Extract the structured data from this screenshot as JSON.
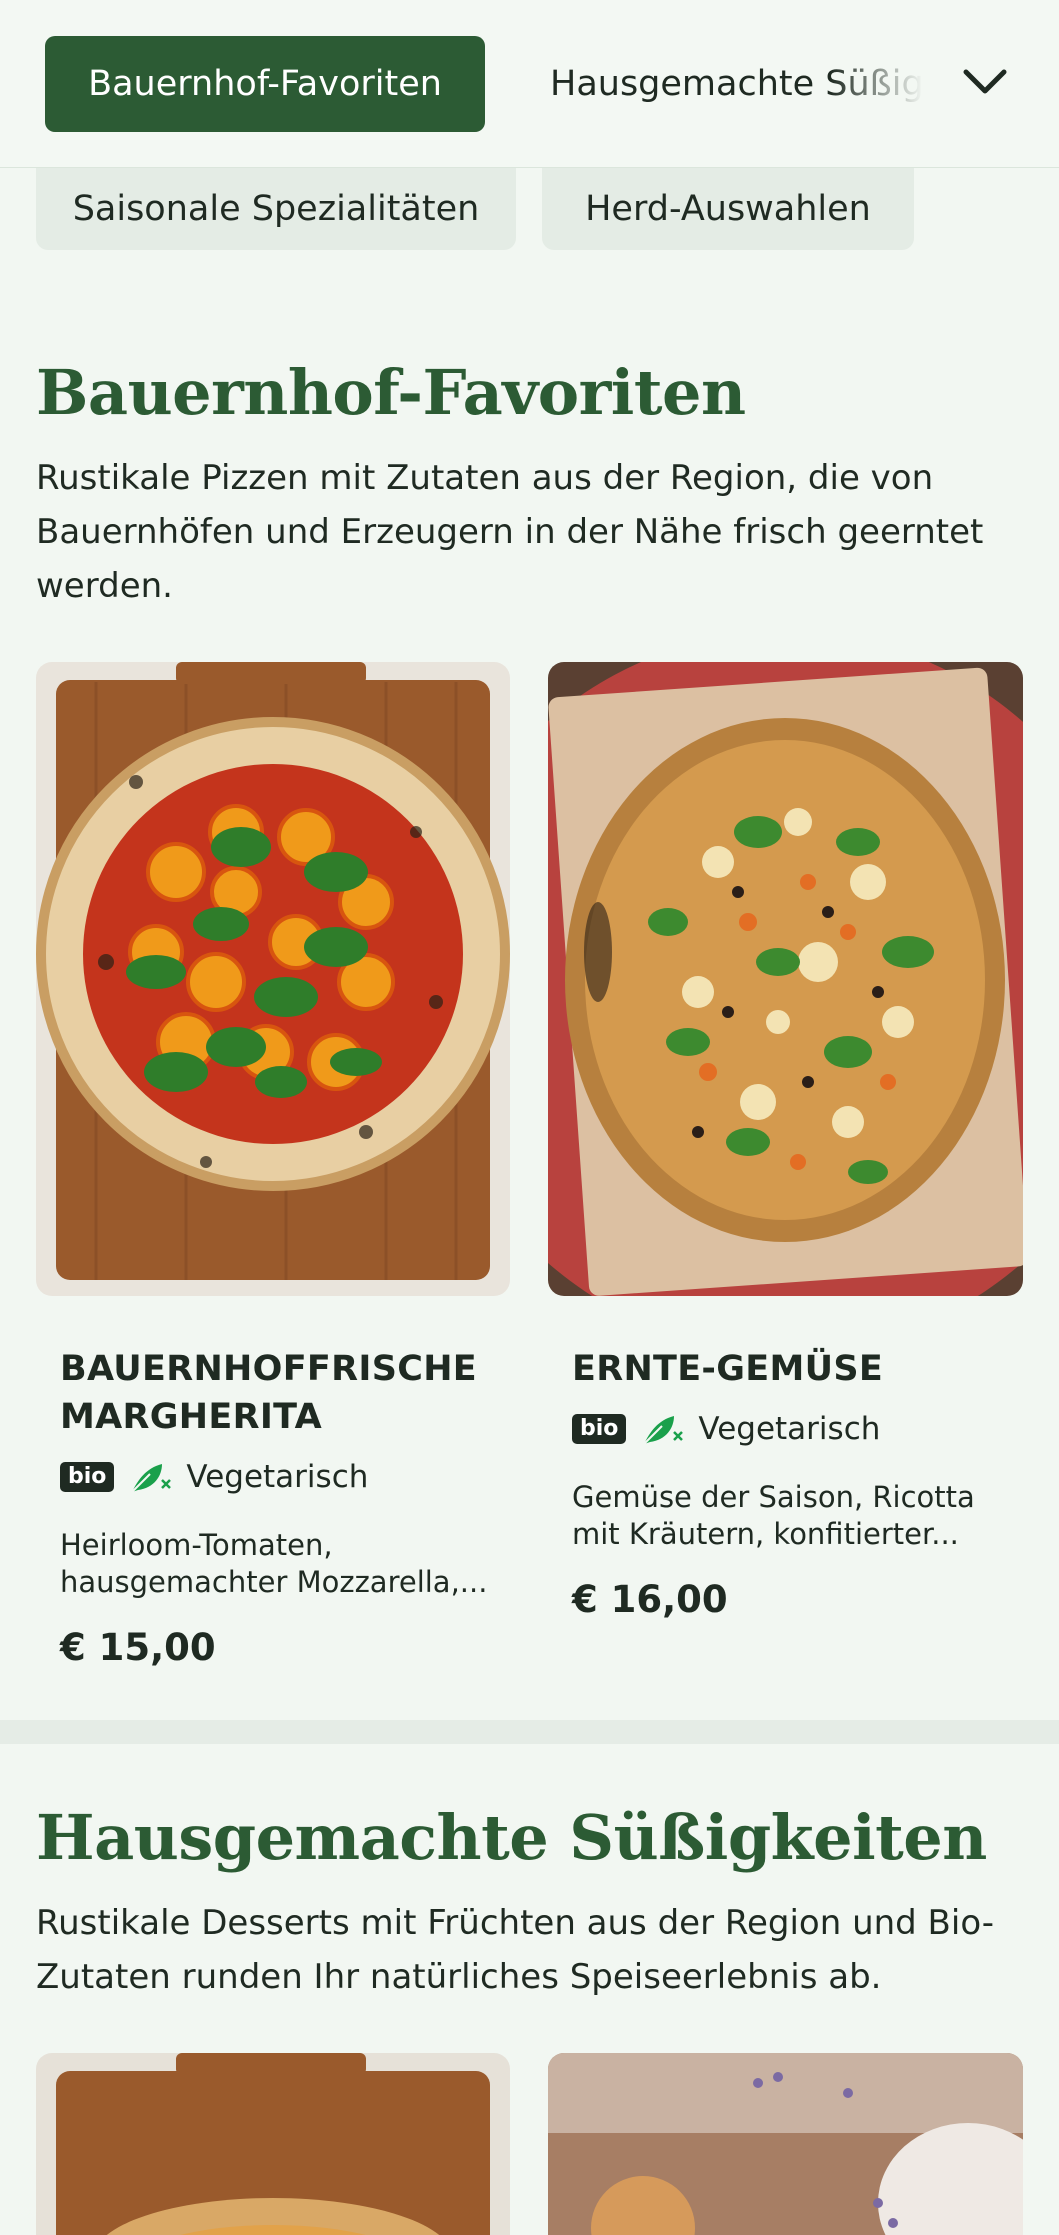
{
  "nav": {
    "active_category": "Bauernhof-Favoriten",
    "next_category": "Hausgemachte Süßigkeiten",
    "second_row": [
      "Saisonale Spezialitäten",
      "Herd-Auswahlen"
    ]
  },
  "sections": [
    {
      "title": "Bauernhof-Favoriten",
      "description": "Rustikale Pizzen mit Zutaten aus der Region, die von Bauernhöfen und Erzeugern in der Nähe frisch geerntet werden.",
      "items": [
        {
          "name": "BAUERNHOFFRISCHE MARGHERITA",
          "bio": "bio",
          "diet": "Vegetarisch",
          "description": "Heirloom-Tomaten, hausgemachter Mozzarella,...",
          "price": "€ 15,00"
        },
        {
          "name": "ERNTE-GEMÜSE",
          "bio": "bio",
          "diet": "Vegetarisch",
          "description": "Gemüse der Saison, Ricotta mit Kräutern, konfitierter...",
          "price": "€ 16,00"
        }
      ]
    },
    {
      "title": "Hausgemachte Süßigkeiten",
      "description": "Rustikale Desserts mit Früchten aus der Region und Bio-Zutaten runden Ihr natürliches Speiseerlebnis ab."
    }
  ],
  "icons": [
    "chevron-down-icon",
    "vegetarian-leaf-icon"
  ],
  "colors": {
    "brand_green": "#2c5b34",
    "background": "#f2f7f2",
    "veg_green": "#1aa04b"
  }
}
